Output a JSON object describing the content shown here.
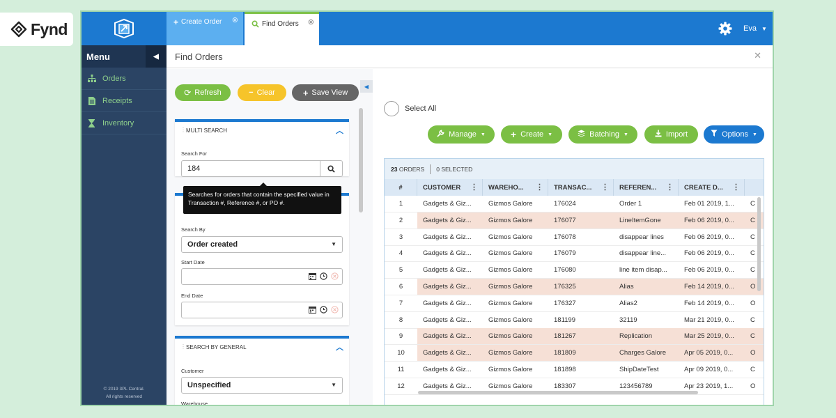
{
  "brand": {
    "logo_text": "fynd"
  },
  "topbar": {
    "tabs": [
      {
        "label": "Create Order",
        "icon": "plus-icon"
      },
      {
        "label": "Find Orders",
        "icon": "search-icon"
      }
    ],
    "user": "Eva"
  },
  "sidebar": {
    "title": "Menu",
    "items": [
      {
        "label": "Orders",
        "icon": "hierarchy-icon"
      },
      {
        "label": "Receipts",
        "icon": "document-icon"
      },
      {
        "label": "Inventory",
        "icon": "hourglass-icon"
      }
    ],
    "copyright_line1": "© 2019 3PL Central.",
    "copyright_line2": "All rights reserved"
  },
  "page": {
    "title": "Find Orders"
  },
  "search_panel": {
    "refresh": "Refresh",
    "clear": "Clear",
    "save_view": "Save View",
    "multi_search": {
      "title": "MULTI SEARCH",
      "search_for_label": "Search For",
      "search_for_value": "184",
      "tooltip": "Searches for orders that contain the specified value in Transaction #, Reference #, or PO #."
    },
    "date_card": {
      "search_by_label": "Search By",
      "search_by_value": "Order created",
      "start_date_label": "Start Date",
      "end_date_label": "End Date"
    },
    "general": {
      "title": "SEARCH BY GENERAL",
      "customer_label": "Customer",
      "customer_value": "Unspecified",
      "warehouse_label": "Warehouse"
    }
  },
  "orders": {
    "select_all": "Select All",
    "actions": {
      "manage": "Manage",
      "create": "Create",
      "batching": "Batching",
      "import": "Import",
      "options": "Options"
    },
    "count": "23",
    "count_label": "ORDERS",
    "selected": "0",
    "selected_label": "SELECTED",
    "columns": [
      "#",
      "CUSTOMER",
      "WAREHO...",
      "TRANSAC...",
      "REFEREN...",
      "CREATE D..."
    ],
    "rows": [
      {
        "n": "1",
        "customer": "Gadgets & Giz...",
        "warehouse": "Gizmos Galore",
        "transaction": "176024",
        "reference": "Order 1",
        "created": "Feb 01 2019, 1...",
        "extra": "C",
        "highlight": false
      },
      {
        "n": "2",
        "customer": "Gadgets & Giz...",
        "warehouse": "Gizmos Galore",
        "transaction": "176077",
        "reference": "LineItemGone",
        "created": "Feb 06 2019, 0...",
        "extra": "C",
        "highlight": true
      },
      {
        "n": "3",
        "customer": "Gadgets & Giz...",
        "warehouse": "Gizmos Galore",
        "transaction": "176078",
        "reference": "disappear lines",
        "created": "Feb 06 2019, 0...",
        "extra": "C",
        "highlight": false
      },
      {
        "n": "4",
        "customer": "Gadgets & Giz...",
        "warehouse": "Gizmos Galore",
        "transaction": "176079",
        "reference": "disappear line...",
        "created": "Feb 06 2019, 0...",
        "extra": "C",
        "highlight": false
      },
      {
        "n": "5",
        "customer": "Gadgets & Giz...",
        "warehouse": "Gizmos Galore",
        "transaction": "176080",
        "reference": "line item disap...",
        "created": "Feb 06 2019, 0...",
        "extra": "C",
        "highlight": false
      },
      {
        "n": "6",
        "customer": "Gadgets & Giz...",
        "warehouse": "Gizmos Galore",
        "transaction": "176325",
        "reference": "Alias",
        "created": "Feb 14 2019, 0...",
        "extra": "O",
        "highlight": true
      },
      {
        "n": "7",
        "customer": "Gadgets & Giz...",
        "warehouse": "Gizmos Galore",
        "transaction": "176327",
        "reference": "Alias2",
        "created": "Feb 14 2019, 0...",
        "extra": "O",
        "highlight": false
      },
      {
        "n": "8",
        "customer": "Gadgets & Giz...",
        "warehouse": "Gizmos Galore",
        "transaction": "181199",
        "reference": "32119",
        "created": "Mar 21 2019, 0...",
        "extra": "C",
        "highlight": false
      },
      {
        "n": "9",
        "customer": "Gadgets & Giz...",
        "warehouse": "Gizmos Galore",
        "transaction": "181267",
        "reference": "Replication",
        "created": "Mar 25 2019, 0...",
        "extra": "C",
        "highlight": true
      },
      {
        "n": "10",
        "customer": "Gadgets & Giz...",
        "warehouse": "Gizmos Galore",
        "transaction": "181809",
        "reference": "Charges Galore",
        "created": "Apr 05 2019, 0...",
        "extra": "O",
        "highlight": true
      },
      {
        "n": "11",
        "customer": "Gadgets & Giz...",
        "warehouse": "Gizmos Galore",
        "transaction": "181898",
        "reference": "ShipDateTest",
        "created": "Apr 09 2019, 0...",
        "extra": "C",
        "highlight": false
      },
      {
        "n": "12",
        "customer": "Gadgets & Giz...",
        "warehouse": "Gizmos Galore",
        "transaction": "183307",
        "reference": "123456789",
        "created": "Apr 23 2019, 1...",
        "extra": "O",
        "highlight": false
      }
    ]
  },
  "colors": {
    "topbar": "#1c79d0",
    "sidebar": "#2b4464",
    "accent_green": "#7bbf44",
    "accent_yellow": "#f6c42a",
    "row_highlight": "#f6e0d6"
  }
}
